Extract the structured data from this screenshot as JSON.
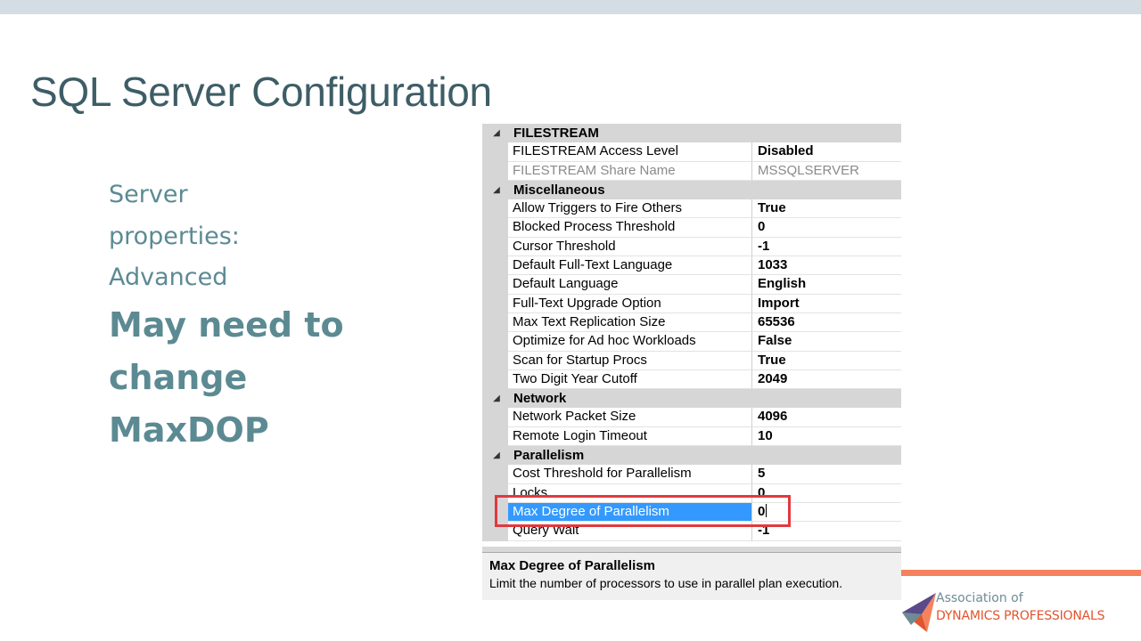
{
  "slide": {
    "title": "SQL Server Configuration",
    "sub_lines": [
      "Server",
      "properties:",
      "Advanced"
    ],
    "emph_lines": [
      "May need to",
      "change",
      "MaxDOP"
    ]
  },
  "grid": {
    "rows": [
      {
        "type": "category",
        "label": "FILESTREAM"
      },
      {
        "type": "property",
        "name": "FILESTREAM Access Level",
        "value": "Disabled"
      },
      {
        "type": "property",
        "name": "FILESTREAM Share Name",
        "value": "MSSQLSERVER",
        "disabled": true
      },
      {
        "type": "category",
        "label": "Miscellaneous"
      },
      {
        "type": "property",
        "name": "Allow Triggers to Fire Others",
        "value": "True"
      },
      {
        "type": "property",
        "name": "Blocked Process Threshold",
        "value": "0"
      },
      {
        "type": "property",
        "name": "Cursor Threshold",
        "value": "-1"
      },
      {
        "type": "property",
        "name": "Default Full-Text Language",
        "value": "1033"
      },
      {
        "type": "property",
        "name": "Default Language",
        "value": "English"
      },
      {
        "type": "property",
        "name": "Full-Text Upgrade Option",
        "value": "Import"
      },
      {
        "type": "property",
        "name": "Max Text Replication Size",
        "value": "65536"
      },
      {
        "type": "property",
        "name": "Optimize for Ad hoc Workloads",
        "value": "False"
      },
      {
        "type": "property",
        "name": "Scan for Startup Procs",
        "value": "True"
      },
      {
        "type": "property",
        "name": "Two Digit Year Cutoff",
        "value": "2049"
      },
      {
        "type": "category",
        "label": "Network"
      },
      {
        "type": "property",
        "name": "Network Packet Size",
        "value": "4096"
      },
      {
        "type": "property",
        "name": "Remote Login Timeout",
        "value": "10"
      },
      {
        "type": "category",
        "label": "Parallelism"
      },
      {
        "type": "property",
        "name": "Cost Threshold for Parallelism",
        "value": "5"
      },
      {
        "type": "property",
        "name": "Locks",
        "value": "0"
      },
      {
        "type": "property",
        "name": "Max Degree of Parallelism",
        "value": "0",
        "selected": true
      },
      {
        "type": "property",
        "name": "Query Wait",
        "value": "-1"
      }
    ],
    "description": {
      "title": "Max Degree of Parallelism",
      "text": "Limit the number of processors to use in parallel plan execution."
    }
  },
  "logo": {
    "line1": "Association of",
    "line2": "DYNAMICS PROFESSIONALS",
    "colors": {
      "teal": "#6d8c95",
      "orange": "#e2542e",
      "purple": "#5a4a8a"
    }
  },
  "colors": {
    "title": "#3e5d66",
    "body_text": "#5c8a93",
    "selection": "#3399ff",
    "highlight_box": "#e0393e",
    "accent_bar": "#f4825d"
  }
}
